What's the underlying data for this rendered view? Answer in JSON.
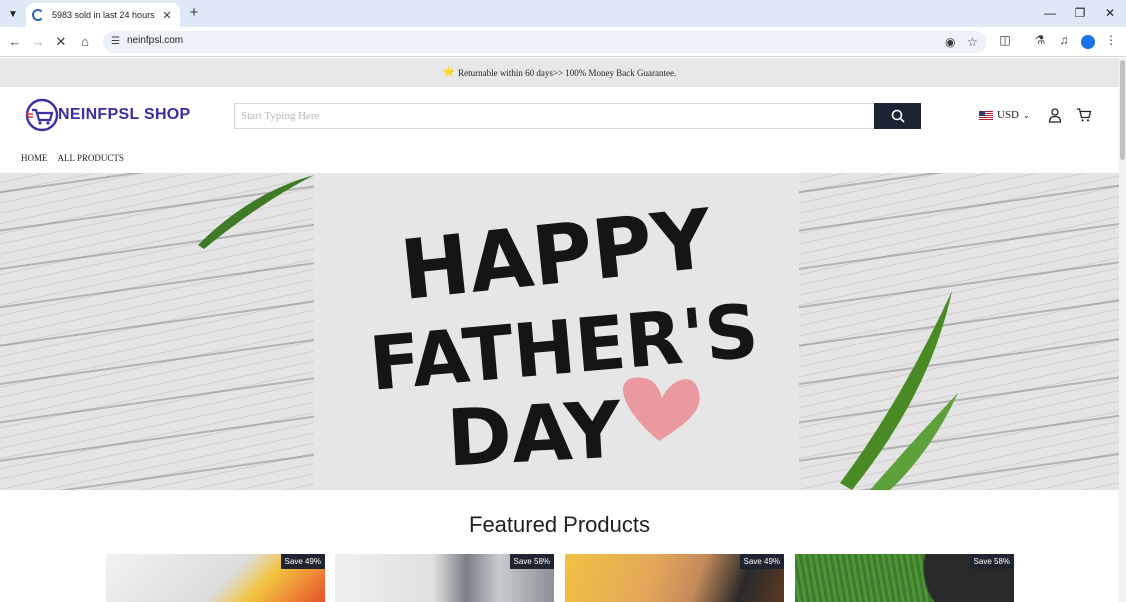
{
  "browser": {
    "tab_title": "5983 sold in last 24 hours",
    "url": "neinfpsl.com"
  },
  "announcement": {
    "icon": "star-icon",
    "text": "Returnable within 60 days>> 100% Money Back Guarantee."
  },
  "header": {
    "logo_text": "NEINFPSL SHOP",
    "search_placeholder": "Start Typing Here",
    "currency": "USD"
  },
  "nav": {
    "items": [
      {
        "label": "HOME"
      },
      {
        "label": "ALL PRODUCTS"
      }
    ]
  },
  "hero": {
    "lines": [
      "HAPPY",
      "FATHER'S",
      "DAY"
    ]
  },
  "featured": {
    "title": "Featured Products",
    "products": [
      {
        "badge": "Save 49%"
      },
      {
        "badge": "Save 58%"
      },
      {
        "badge": "Save 49%"
      },
      {
        "badge": "Save 58%"
      }
    ]
  },
  "colors": {
    "brand": "#3a2fa0",
    "search_button": "#1c2433",
    "announcement_bg": "#e8e8e8",
    "badge_bg": "#1f2530"
  }
}
